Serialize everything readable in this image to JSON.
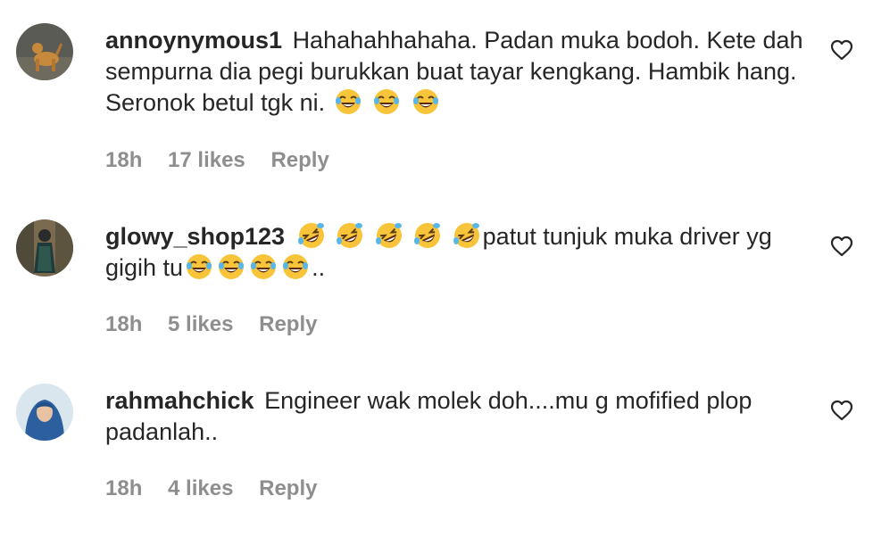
{
  "comments": [
    {
      "username": "annoynymous1",
      "text": "Hahahahhahaha. Padan muka bodoh. Kete dah sempurna dia pegi burukkan buat tayar kengkang. Hambik hang. Seronok betul tgk ni.",
      "trailing_emoji": [
        "joy",
        "joy",
        "joy"
      ],
      "time": "18h",
      "likes": "17 likes",
      "reply": "Reply"
    },
    {
      "username": "glowy_shop123",
      "leading_emoji": [
        "rofl",
        "rofl",
        "rofl",
        "rofl",
        "rofl"
      ],
      "text": "patut tunjuk muka driver yg gigih tu",
      "trailing_emoji": [
        "joy",
        "joy",
        "joy",
        "joy"
      ],
      "suffix": "..",
      "time": "18h",
      "likes": "5 likes",
      "reply": "Reply"
    },
    {
      "username": "rahmahchick",
      "text": "Engineer wak molek doh....mu g mofified plop padanlah..",
      "time": "18h",
      "likes": "4 likes",
      "reply": "Reply"
    }
  ],
  "icons": {
    "like": "heart-outline-icon",
    "joy": "face-with-tears-of-joy-emoji",
    "rofl": "rolling-on-floor-laughing-emoji"
  },
  "colors": {
    "text": "#262626",
    "meta": "#8e8e8e",
    "emoji_face": "#f7c43a"
  }
}
